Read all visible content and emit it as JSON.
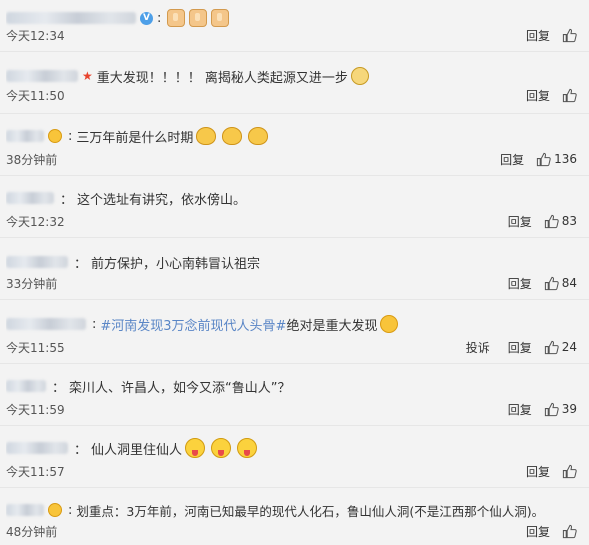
{
  "labels": {
    "reply": "回复",
    "report": "投诉"
  },
  "comments": [
    {
      "text": "",
      "time": "今天12:34",
      "like_count": "",
      "report": false
    },
    {
      "text1": "重大发现！！！！ 离揭秘人类起源又进一步",
      "time": "今天11:50",
      "like_count": "",
      "report": false
    },
    {
      "text": "三万年前是什么时期",
      "time": "38分钟前",
      "like_count": "136",
      "report": false
    },
    {
      "text": "这个选址有讲究，依水傍山。",
      "time": "今天12:32",
      "like_count": "83",
      "report": false
    },
    {
      "text": "前方保护，小心南韩冒认祖宗",
      "time": "33分钟前",
      "like_count": "84",
      "report": false
    },
    {
      "hashtag": "#河南发现3万念前现代人头骨#",
      "text": " 绝对是重大发现",
      "time": "今天11:55",
      "like_count": "24",
      "report": true
    },
    {
      "text": "栾川人、许昌人，如今又添“鲁山人”？",
      "time": "今天11:59",
      "like_count": "39",
      "report": false
    },
    {
      "text": "仙人洞里住仙人",
      "time": "今天11:57",
      "like_count": "",
      "report": false
    },
    {
      "text": "划重点：3万年前，河南已知最早的现代人化石，鲁山仙人洞(不是江西那个仙人洞)。",
      "time": "48分钟前",
      "like_count": "",
      "report": false
    }
  ]
}
